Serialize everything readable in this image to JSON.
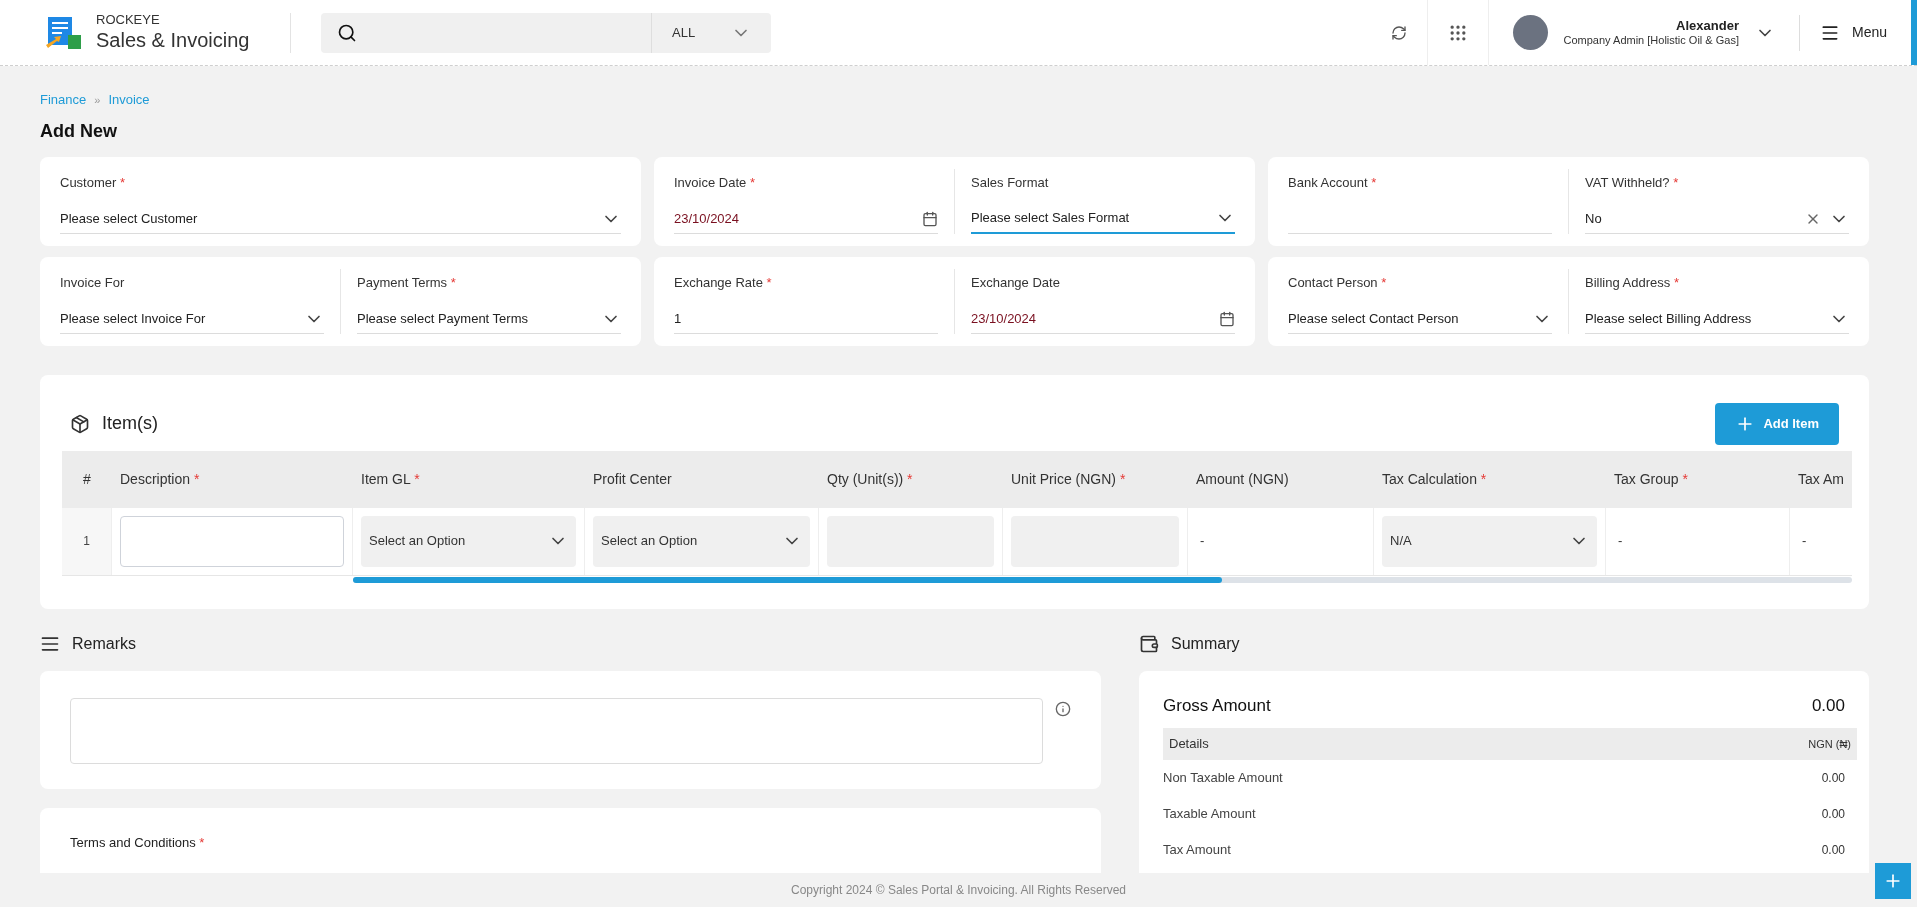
{
  "header": {
    "brand_top": "ROCKEYE",
    "brand_name": "Sales & Invoicing",
    "search": {
      "scope": "ALL"
    },
    "user": {
      "name": "Alexander",
      "role": "Company Admin [Holistic Oil & Gas]"
    },
    "menu_label": "Menu"
  },
  "required_mark": "*",
  "breadcrumb_separator": "»",
  "breadcrumb": [
    {
      "label": "Finance"
    },
    {
      "label": "Invoice"
    }
  ],
  "page_title": "Add New",
  "form_cards": [
    {
      "fields": [
        {
          "label": "Customer",
          "required": true,
          "kind": "select",
          "placeholder": "Please select Customer",
          "focused": false
        }
      ]
    },
    {
      "fields": [
        {
          "label": "Invoice Date",
          "required": true,
          "kind": "date",
          "value": "23/10/2024",
          "focused": false
        },
        {
          "label": "Sales Format",
          "required": false,
          "kind": "select",
          "placeholder": "Please select Sales Format",
          "focused": true
        }
      ]
    },
    {
      "fields": [
        {
          "label": "Bank Account",
          "required": true,
          "kind": "text",
          "focused": false
        },
        {
          "label": "VAT Withheld?",
          "required": true,
          "kind": "select",
          "value": "No",
          "focused": false,
          "clearable": true
        }
      ]
    },
    {
      "fields": [
        {
          "label": "Invoice For",
          "required": false,
          "kind": "select",
          "placeholder": "Please select Invoice For",
          "focused": false
        },
        {
          "label": "Payment Terms",
          "required": true,
          "kind": "select",
          "placeholder": "Please select Payment Terms",
          "focused": false
        }
      ]
    },
    {
      "fields": [
        {
          "label": "Exchange Rate",
          "required": true,
          "kind": "text",
          "value": "1",
          "focused": false
        },
        {
          "label": "Exchange Date",
          "required": false,
          "kind": "date",
          "value": "23/10/2024",
          "focused": false
        }
      ]
    },
    {
      "fields": [
        {
          "label": "Contact Person",
          "required": true,
          "kind": "select",
          "placeholder": "Please select Contact Person",
          "focused": false
        },
        {
          "label": "Billing Address",
          "required": true,
          "kind": "select",
          "placeholder": "Please select Billing Address",
          "focused": false
        }
      ]
    }
  ],
  "items": {
    "title": "Item(s)",
    "add_button": "Add Item",
    "columns": [
      {
        "label": "#",
        "required": false
      },
      {
        "label": "Description",
        "required": true
      },
      {
        "label": "Item GL",
        "required": true
      },
      {
        "label": "Profit Center",
        "required": false
      },
      {
        "label": "Qty (Unit(s))",
        "required": true
      },
      {
        "label": "Unit Price (NGN)",
        "required": true
      },
      {
        "label": "Amount (NGN)",
        "required": false
      },
      {
        "label": "Tax Calculation",
        "required": true
      },
      {
        "label": "Tax Group",
        "required": true
      },
      {
        "label": "Tax Am",
        "required": false
      }
    ],
    "rows": [
      {
        "cells": [
          {
            "kind": "index",
            "text": "1"
          },
          {
            "kind": "input"
          },
          {
            "kind": "select",
            "text": "Select an Option"
          },
          {
            "kind": "select",
            "text": "Select an Option"
          },
          {
            "kind": "filled_input"
          },
          {
            "kind": "filled_input"
          },
          {
            "kind": "text",
            "text": "-"
          },
          {
            "kind": "select",
            "text": "N/A"
          },
          {
            "kind": "text",
            "text": "-"
          },
          {
            "kind": "text",
            "text": "-"
          }
        ]
      }
    ]
  },
  "remarks": {
    "title": "Remarks"
  },
  "terms": {
    "label": "Terms and Conditions",
    "required": true
  },
  "summary": {
    "title": "Summary",
    "gross_label": "Gross Amount",
    "gross_value": "0.00",
    "details_label": "Details",
    "currency_label": "NGN (₦)",
    "rows": [
      {
        "label": "Non Taxable Amount",
        "value": "0.00"
      },
      {
        "label": "Taxable Amount",
        "value": "0.00"
      },
      {
        "label": "Tax Amount",
        "value": "0.00"
      }
    ]
  },
  "footer": "Copyright 2024 © Sales Portal & Invoicing. All Rights Reserved"
}
